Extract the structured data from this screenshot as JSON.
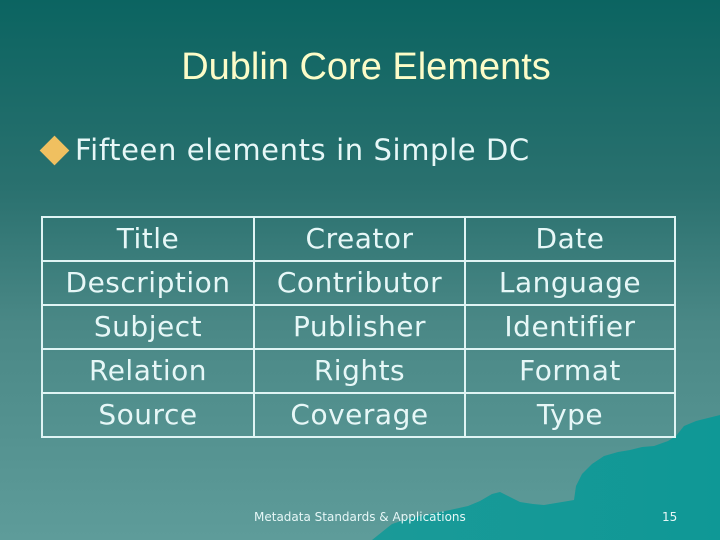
{
  "slide": {
    "title": "Dublin Core Elements",
    "bullet": {
      "icon": "diamond-bullet-icon",
      "text": "Fifteen elements in Simple DC"
    },
    "elements_table": {
      "rows": [
        [
          "Title",
          "Creator",
          "Date"
        ],
        [
          "Description",
          "Contributor",
          "Language"
        ],
        [
          "Subject",
          "Publisher",
          "Identifier"
        ],
        [
          "Relation",
          "Rights",
          "Format"
        ],
        [
          "Source",
          "Coverage",
          "Type"
        ]
      ]
    },
    "footer": "Metadata Standards & Applications",
    "page_number": "15"
  },
  "colors": {
    "title": "#fcfcc8",
    "bullet": "#f0c060",
    "text": "#e6f7f7",
    "background_top": "#0b6461",
    "background_bottom": "#5e9c9a",
    "mountain": "#119b99"
  }
}
